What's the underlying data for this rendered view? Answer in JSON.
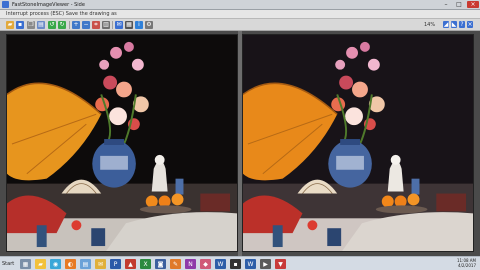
{
  "window": {
    "title": "FastStoneImageViewer - Side",
    "controls": {
      "minimize": "–",
      "maximize": "□",
      "close": "×"
    }
  },
  "infobar": {
    "message": "Interrupt process (ESC)   Save the drawing as"
  },
  "toolbar": {
    "zoom": "14%",
    "icons": [
      "open-folder-icon",
      "save-icon",
      "copy-icon",
      "paste-icon",
      "rotate-left-icon",
      "rotate-right-icon",
      "zoom-in-icon",
      "zoom-out-icon",
      "crop-icon",
      "compare-icon",
      "email-icon",
      "print-icon",
      "info-icon",
      "settings-icon",
      "fit-screen-icon",
      "fullscreen-icon",
      "help-icon",
      "pin-icon",
      "exit-icon"
    ]
  },
  "viewer": {
    "panes": [
      "left-image",
      "right-image"
    ]
  },
  "taskbar": {
    "start_label": "Start",
    "clock_time": "11:08 AM",
    "clock_date": "4/2/2017",
    "apps": [
      "explorer",
      "chrome",
      "firefox",
      "notes",
      "outlook",
      "photoshop",
      "excel",
      "camera",
      "paint",
      "onenote",
      "word",
      "vlc",
      "audio",
      "word-w",
      "network"
    ]
  },
  "colors": {
    "accent": "#3b6fd1",
    "close": "#c93a31",
    "umbrella": "#e7951e",
    "vase_blue": "#3c5e9a"
  }
}
